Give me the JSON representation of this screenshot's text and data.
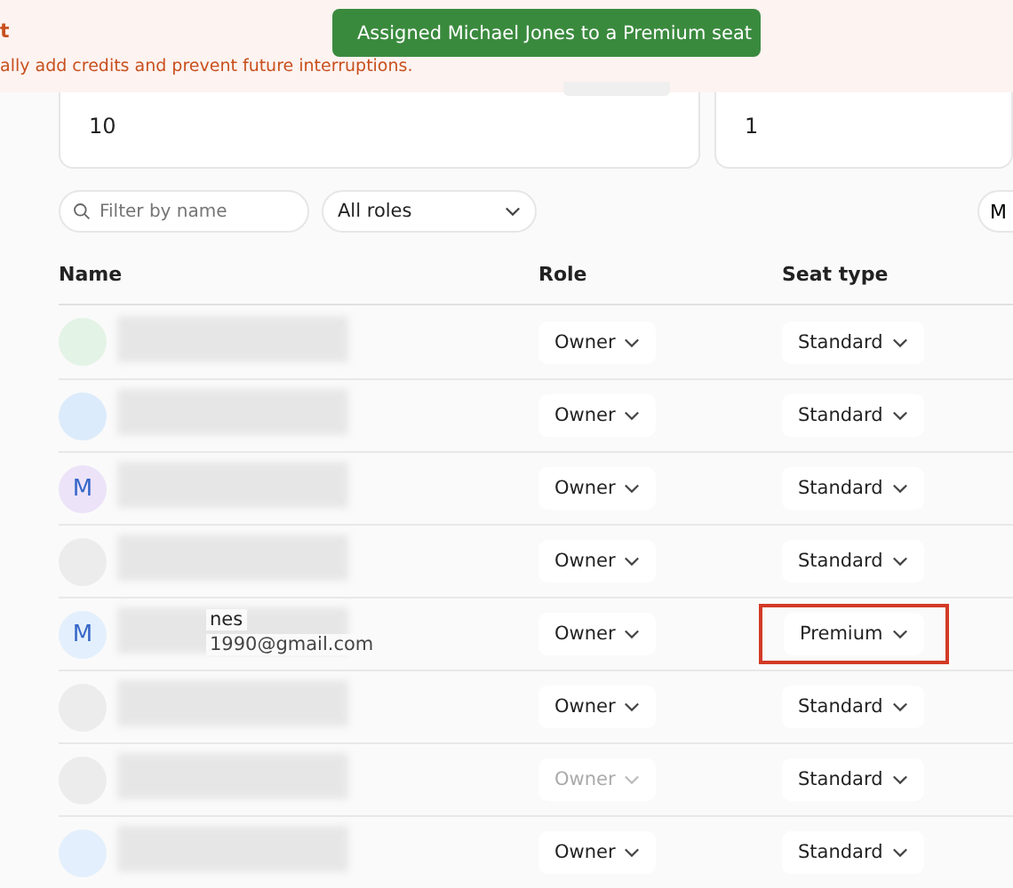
{
  "banner": {
    "title": "t",
    "message": "ally add credits and prevent future interruptions."
  },
  "toast": {
    "message": "Assigned Michael Jones to a Premium seat"
  },
  "cards": [
    {
      "value": "10"
    },
    {
      "value": "1"
    }
  ],
  "filters": {
    "search": {
      "placeholder": "Filter by name"
    },
    "role_select": {
      "value": "All roles"
    },
    "button_partial": "M"
  },
  "table": {
    "columns": [
      "Name",
      "Role",
      "Seat type"
    ],
    "rows": [
      {
        "avatar": "",
        "color": "#e3f3e6",
        "name": "",
        "email": "",
        "role": "Owner",
        "role_disabled": false,
        "seat": "Standard",
        "highlighted": false
      },
      {
        "avatar": "",
        "color": "#dcebfb",
        "name": "",
        "email": "",
        "role": "Owner",
        "role_disabled": false,
        "seat": "Standard",
        "highlighted": false
      },
      {
        "avatar": "M",
        "color": "#ece3f8",
        "name": "",
        "email": "",
        "role": "Owner",
        "role_disabled": false,
        "seat": "Standard",
        "highlighted": false
      },
      {
        "avatar": "",
        "color": "#ececec",
        "name": "",
        "email": "",
        "role": "Owner",
        "role_disabled": false,
        "seat": "Standard",
        "highlighted": false
      },
      {
        "avatar": "M",
        "color": "#e3effc",
        "name": "nes",
        "email": "1990@gmail.com",
        "role": "Owner",
        "role_disabled": false,
        "seat": "Premium",
        "highlighted": true
      },
      {
        "avatar": "",
        "color": "#ececec",
        "name": "",
        "email": "",
        "role": "Owner",
        "role_disabled": false,
        "seat": "Standard",
        "highlighted": false
      },
      {
        "avatar": "",
        "color": "#ececec",
        "name": "",
        "email": "",
        "role": "Owner",
        "role_disabled": true,
        "seat": "Standard",
        "highlighted": false
      },
      {
        "avatar": "",
        "color": "#e3effc",
        "name": "",
        "email": "",
        "role": "Owner",
        "role_disabled": false,
        "seat": "Standard",
        "highlighted": false
      }
    ]
  }
}
